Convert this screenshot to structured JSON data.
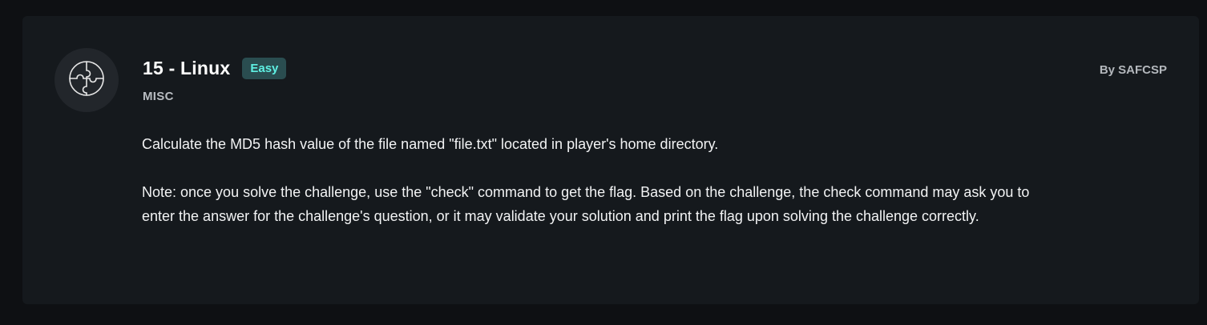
{
  "challenge": {
    "title": "15 - Linux",
    "difficulty": "Easy",
    "category": "MISC",
    "author": "By SAFCSP",
    "icon": "puzzle-icon",
    "description": [
      "Calculate the MD5 hash value of the file named \"file.txt\" located in player's home directory.",
      "Note: once you solve the challenge, use the \"check\" command to get the flag. Based on the challenge, the check command may ask you to enter the answer for the challenge's question, or it may validate your solution and print the flag upon solving the challenge correctly."
    ]
  },
  "colors": {
    "page_bg": "#0e1013",
    "card_bg": "#15191d",
    "badge_bg": "#2a4d50",
    "badge_text": "#5ff0e3"
  }
}
